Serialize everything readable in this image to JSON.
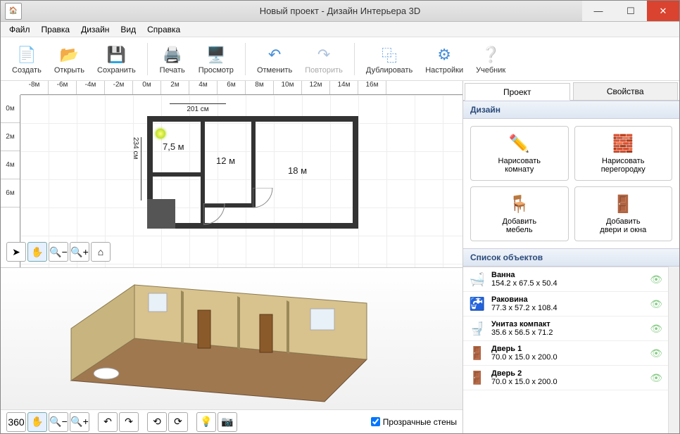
{
  "window": {
    "title": "Новый проект - Дизайн Интерьера 3D"
  },
  "menu": {
    "file": "Файл",
    "edit": "Правка",
    "design": "Дизайн",
    "view": "Вид",
    "help": "Справка"
  },
  "toolbar": {
    "create": "Создать",
    "open": "Открыть",
    "save": "Сохранить",
    "print": "Печать",
    "preview": "Просмотр",
    "undo": "Отменить",
    "redo": "Повторить",
    "duplicate": "Дублировать",
    "settings": "Настройки",
    "tutorial": "Учебник"
  },
  "ruler_h": [
    "-8м",
    "-6м",
    "-4м",
    "-2м",
    "0м",
    "2м",
    "4м",
    "6м",
    "8м",
    "10м",
    "12м",
    "14м",
    "16м"
  ],
  "ruler_v": [
    "0м",
    "2м",
    "4м",
    "6м"
  ],
  "plan": {
    "dim_top": "201 см",
    "dim_left": "234 см",
    "room1": "7,5 м",
    "room2": "12 м",
    "room3": "18 м"
  },
  "view3d": {
    "transparent_walls": "Прозрачные стены"
  },
  "tabs": {
    "project": "Проект",
    "properties": "Свойства"
  },
  "panel": {
    "design_hdr": "Дизайн",
    "draw_room_l1": "Нарисовать",
    "draw_room_l2": "комнату",
    "draw_partition_l1": "Нарисовать",
    "draw_partition_l2": "перегородку",
    "add_furniture_l1": "Добавить",
    "add_furniture_l2": "мебель",
    "add_doors_l1": "Добавить",
    "add_doors_l2": "двери и окна",
    "objects_hdr": "Список объектов"
  },
  "objects": [
    {
      "name": "Ванна",
      "dims": "154.2 x 67.5 x 50.4",
      "icon": "bath"
    },
    {
      "name": "Раковина",
      "dims": "77.3 x 57.2 x 108.4",
      "icon": "sink"
    },
    {
      "name": "Унитаз компакт",
      "dims": "35.6 x 56.5 x 71.2",
      "icon": "toilet"
    },
    {
      "name": "Дверь 1",
      "dims": "70.0 x 15.0 x 200.0",
      "icon": "door"
    },
    {
      "name": "Дверь 2",
      "dims": "70.0 x 15.0 x 200.0",
      "icon": "door"
    }
  ]
}
